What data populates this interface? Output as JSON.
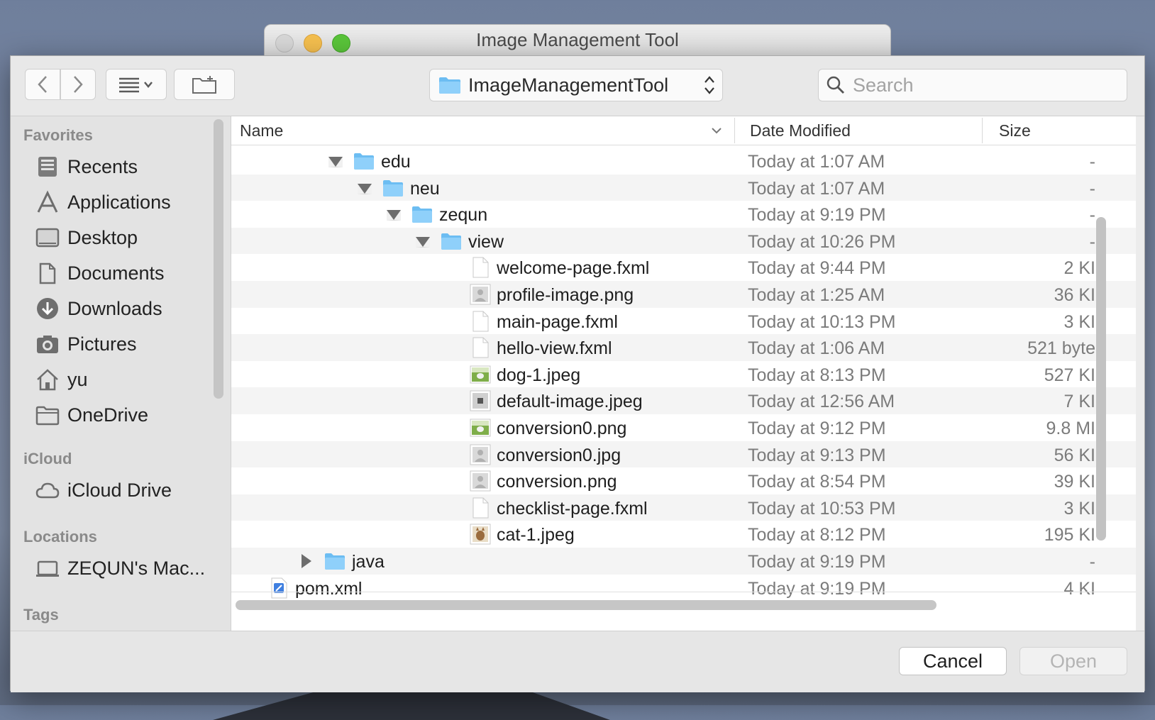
{
  "window": {
    "title": "Image Management Tool"
  },
  "toolbar": {
    "path_label": "ImageManagementTool",
    "search_placeholder": "Search"
  },
  "sidebar": {
    "favorites_header": "Favorites",
    "favorites": [
      {
        "label": "Recents",
        "icon": "recents-icon"
      },
      {
        "label": "Applications",
        "icon": "applications-icon"
      },
      {
        "label": "Desktop",
        "icon": "desktop-icon"
      },
      {
        "label": "Documents",
        "icon": "documents-icon"
      },
      {
        "label": "Downloads",
        "icon": "downloads-icon"
      },
      {
        "label": "Pictures",
        "icon": "pictures-icon"
      },
      {
        "label": "yu",
        "icon": "home-icon"
      },
      {
        "label": "OneDrive",
        "icon": "folder-icon"
      }
    ],
    "icloud_header": "iCloud",
    "icloud": [
      {
        "label": "iCloud Drive",
        "icon": "cloud-icon"
      }
    ],
    "locations_header": "Locations",
    "locations": [
      {
        "label": "ZEQUN's Mac...",
        "icon": "laptop-icon"
      }
    ],
    "tags_header": "Tags"
  },
  "columns": {
    "name": "Name",
    "date": "Date Modified",
    "size": "Size"
  },
  "files": [
    {
      "name": "edu",
      "date": "Today at 1:07 AM",
      "size": "-"
    },
    {
      "name": "neu",
      "date": "Today at 1:07 AM",
      "size": "-"
    },
    {
      "name": "zequn",
      "date": "Today at 9:19 PM",
      "size": "-"
    },
    {
      "name": "view",
      "date": "Today at 10:26 PM",
      "size": "-"
    },
    {
      "name": "welcome-page.fxml",
      "date": "Today at 9:44 PM",
      "size": "2 KI"
    },
    {
      "name": "profile-image.png",
      "date": "Today at 1:25 AM",
      "size": "36 KI"
    },
    {
      "name": "main-page.fxml",
      "date": "Today at 10:13 PM",
      "size": "3 KI"
    },
    {
      "name": "hello-view.fxml",
      "date": "Today at 1:06 AM",
      "size": "521 byte"
    },
    {
      "name": "dog-1.jpeg",
      "date": "Today at 8:13 PM",
      "size": "527 KI"
    },
    {
      "name": "default-image.jpeg",
      "date": "Today at 12:56 AM",
      "size": "7 KI"
    },
    {
      "name": "conversion0.png",
      "date": "Today at 9:12 PM",
      "size": "9.8 MI"
    },
    {
      "name": "conversion0.jpg",
      "date": "Today at 9:13 PM",
      "size": "56 KI"
    },
    {
      "name": "conversion.png",
      "date": "Today at 8:54 PM",
      "size": "39 KI"
    },
    {
      "name": "checklist-page.fxml",
      "date": "Today at 10:53 PM",
      "size": "3 KI"
    },
    {
      "name": "cat-1.jpeg",
      "date": "Today at 8:12 PM",
      "size": "195 KI"
    },
    {
      "name": "java",
      "date": "Today at 9:19 PM",
      "size": "-"
    },
    {
      "name": "pom.xml",
      "date": "Today at 9:19 PM",
      "size": "4 KI"
    }
  ],
  "footer": {
    "cancel": "Cancel",
    "open": "Open"
  }
}
